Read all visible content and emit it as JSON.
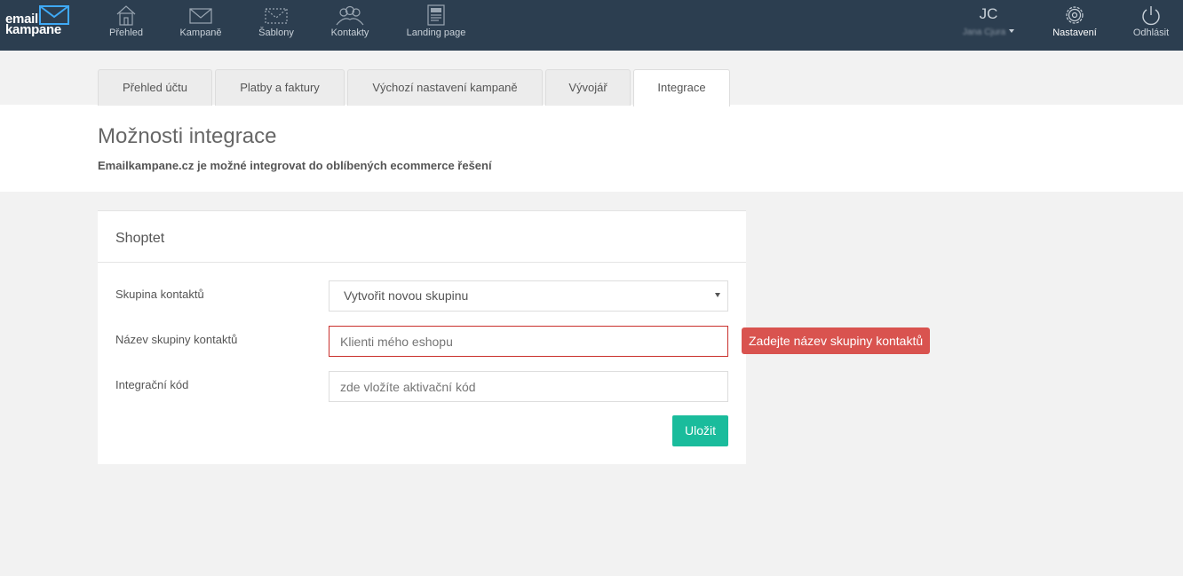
{
  "brand": {
    "line1": "email",
    "line2": "kampane",
    "icon": "envelope-icon"
  },
  "nav": [
    {
      "label": "Přehled",
      "icon": "home-icon"
    },
    {
      "label": "Kampaně",
      "icon": "envelope-icon"
    },
    {
      "label": "Šablony",
      "icon": "template-icon"
    },
    {
      "label": "Kontakty",
      "icon": "contacts-icon"
    },
    {
      "label": "Landing page",
      "icon": "landing-page-icon"
    }
  ],
  "user": {
    "initials": "JC",
    "name": "Jana Cjura"
  },
  "right_nav": [
    {
      "label": "Nastavení",
      "icon": "gear-icon"
    },
    {
      "label": "Odhlásit",
      "icon": "power-icon"
    }
  ],
  "tabs": [
    "Přehled účtu",
    "Platby a faktury",
    "Výchozí nastavení kampaně",
    "Vývojář",
    "Integrace"
  ],
  "active_tab": "Integrace",
  "page": {
    "title": "Možnosti integrace",
    "subtitle": "Emailkampane.cz je možné integrovat do oblíbených ecommerce řešení"
  },
  "card": {
    "title": "Shoptet",
    "group_label": "Skupina kontaktů",
    "group_value": "Vytvořit novou skupinu",
    "group_name_label": "Název skupiny kontaktů",
    "group_name_placeholder": "Klienti mého eshopu",
    "group_name_error": "Zadejte název skupiny kontaktů",
    "code_label": "Integrační kód",
    "code_placeholder": "zde vložíte aktivační kód",
    "save_label": "Uložit"
  },
  "colors": {
    "topbar": "#2c3e50",
    "save": "#1abc9c",
    "error": "#d9534f"
  }
}
